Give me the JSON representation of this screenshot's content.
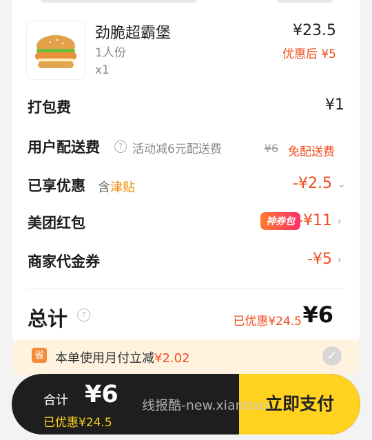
{
  "item": {
    "name": "劲脆超霸堡",
    "serving": "1人份",
    "qty": "x1",
    "price": "¥23.5",
    "discounted": "优惠后 ¥5",
    "image_icon": "burger-image"
  },
  "fees": {
    "packing_label": "打包费",
    "packing_value": "¥1",
    "delivery_label": "用户配送费",
    "delivery_note": "活动减6元配送费",
    "delivery_original": "¥6",
    "delivery_free": "免配送费"
  },
  "discounts": {
    "enjoyed_label": "已享优惠",
    "enjoyed_tag_prefix": "含",
    "enjoyed_tag": "津贴",
    "enjoyed_value": "-¥2.5",
    "redpacket_label": "美团红包",
    "redpacket_badge": "神券包",
    "redpacket_value": "-¥11",
    "voucher_label": "商家代金券",
    "voucher_value": "-¥5"
  },
  "total": {
    "label": "总计",
    "saved": "已优惠¥24.5",
    "amount": "¥6"
  },
  "monthly_pay": {
    "icon": "省",
    "text": "本单使用月付立减",
    "amount": "¥2.02"
  },
  "paybar": {
    "label": "合计",
    "amount": "¥6",
    "saved": "已优惠¥24.5",
    "button": "立即支付"
  },
  "watermark": "线报酷-new.xianbao",
  "colors": {
    "accent_red": "#f24a1d",
    "pay_yellow": "#ffd21f",
    "bar_dark": "#1e1e1e"
  }
}
